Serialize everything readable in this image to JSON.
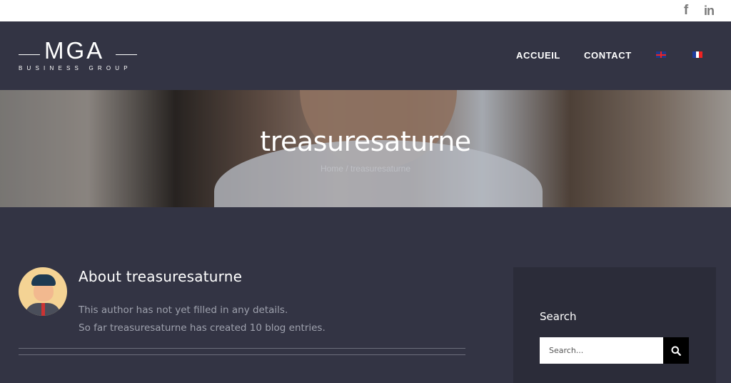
{
  "topbar": {
    "social": [
      {
        "icon": "facebook-icon",
        "glyph": "f"
      },
      {
        "icon": "linkedin-icon",
        "glyph": "in"
      }
    ]
  },
  "header": {
    "logo": {
      "main": "MGA",
      "sub": "BUSINESS GROUP"
    },
    "nav": [
      {
        "label": "ACCUEIL"
      },
      {
        "label": "CONTACT"
      }
    ],
    "languages": [
      {
        "icon": "flag-en-icon"
      },
      {
        "icon": "flag-fr-icon"
      }
    ]
  },
  "hero": {
    "title": "treasuresaturne",
    "breadcrumb": "Home / treasuresaturne"
  },
  "author": {
    "title": "About treasuresaturne",
    "line1": "This author has not yet filled in any details.",
    "line2": "So far treasuresaturne has created 10 blog entries."
  },
  "sidebar": {
    "search_heading": "Search",
    "search_placeholder": "Search...",
    "search_icon": "search-icon"
  },
  "colors": {
    "background": "#333444",
    "sidebar": "#2b2c39",
    "accent_button": "#000000"
  }
}
